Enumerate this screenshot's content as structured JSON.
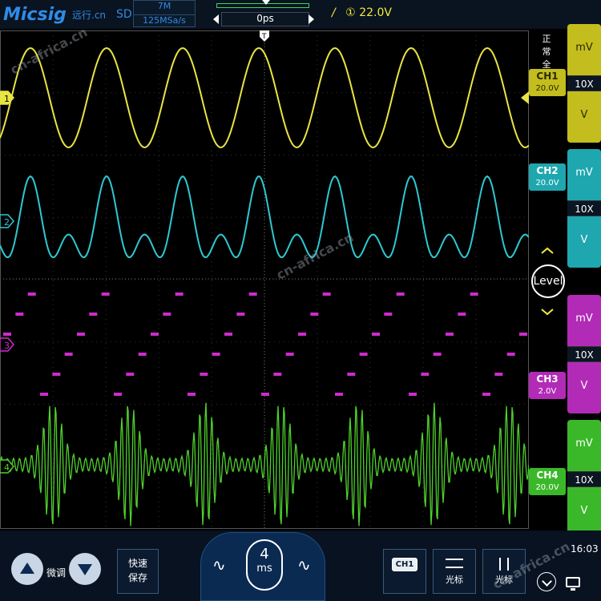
{
  "header": {
    "brand": "Micsig",
    "brand_sub": "远行.cn",
    "mode": "SD",
    "memory_depth": "7M",
    "sample_rate": "125MSa/s",
    "horizontal_position": "0ps",
    "trigger_channel_marker": "①",
    "trigger_level": "22.0V"
  },
  "status": {
    "run_state": "正常",
    "trigger_type": "全"
  },
  "channels": [
    {
      "name": "CH1",
      "scale": "20.0V",
      "marker": "1",
      "color": "#e8e542",
      "panel_color": "#c3bd1e",
      "text_color": "#2a2a00"
    },
    {
      "name": "CH2",
      "scale": "20.0V",
      "marker": "2",
      "color": "#2ec9d2",
      "panel_color": "#1fa7b0",
      "text_color": "#ffffff"
    },
    {
      "name": "CH3",
      "scale": "2.0V",
      "marker": "3",
      "color": "#cc2ccc",
      "panel_color": "#b12bb6",
      "text_color": "#ffffff"
    },
    {
      "name": "CH4",
      "scale": "20.0V",
      "marker": "4",
      "color": "#4fd12c",
      "panel_color": "#3bb82a",
      "text_color": "#ffffff"
    }
  ],
  "gain_control": {
    "unit_small": "mV",
    "factor": "10X",
    "unit_large": "V"
  },
  "level_button": {
    "label": "Level"
  },
  "bottom": {
    "fine_label": "微调",
    "save_line1": "快速",
    "save_line2": "保存",
    "timebase_value": "4",
    "timebase_unit": "ms",
    "ch1_chip": "CH1",
    "cursor1_label": "光标",
    "cursor2_label": "光标",
    "time": "16:03"
  },
  "watermarks": [
    "cn-africa.cn",
    "cn-africa.cn",
    "cn-africa.cn"
  ]
}
